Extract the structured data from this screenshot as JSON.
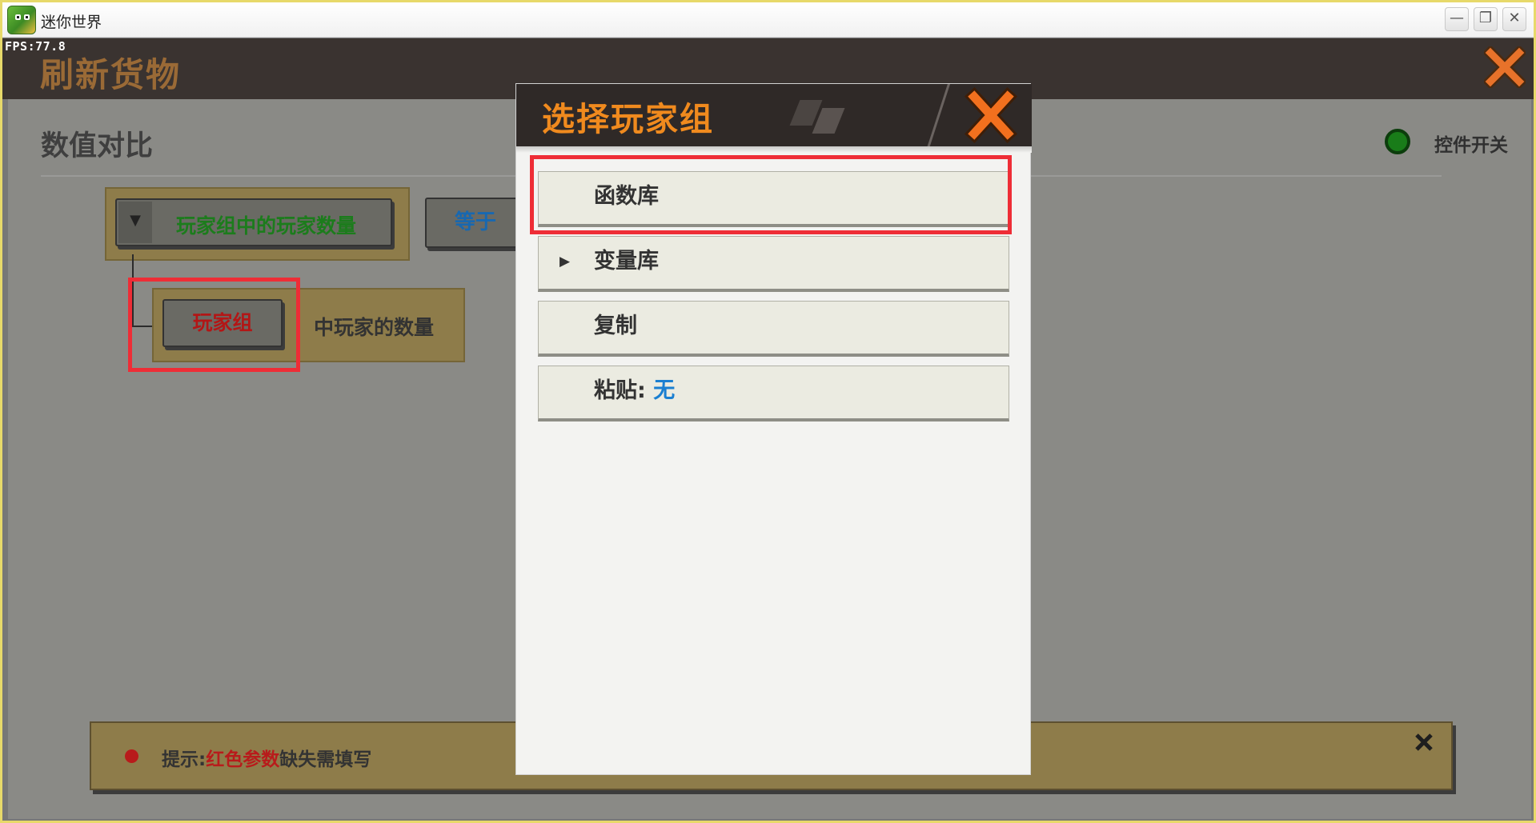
{
  "window": {
    "title": "迷你世界",
    "controls": {
      "minimize": "—",
      "restore": "❐",
      "close": "✕"
    }
  },
  "fps": "FPS:77.8",
  "page": {
    "title": "刷新货物",
    "section_title": "数值对比",
    "toggle_label": "控件开关"
  },
  "condition": {
    "block_label": "玩家组中的玩家数量",
    "operator_label": "等于",
    "sub_param": "玩家组",
    "sub_text": "中玩家的数量"
  },
  "hint": {
    "prefix": "提示:",
    "red_part": "红色参数",
    "suffix": "缺失需填写"
  },
  "dialog": {
    "title": "选择玩家组",
    "items": [
      {
        "label": "函数库"
      },
      {
        "label": "变量库",
        "has_submenu": true
      },
      {
        "label": "复制"
      },
      {
        "label": "粘贴:",
        "value": "无"
      }
    ]
  },
  "colors": {
    "accent_orange": "#f08a1e",
    "highlight_red": "#ee2d36",
    "param_red": "#b31616",
    "param_green": "#1c7c1c",
    "operator_blue": "#1868b0",
    "toggle_on": "#197c19"
  },
  "icons": {
    "app": "mini-world-app-icon",
    "close": "orange-x-close-icon",
    "dropdown": "triangle-down-icon",
    "submenu": "triangle-right-icon",
    "hint_close": "x-close-icon"
  }
}
